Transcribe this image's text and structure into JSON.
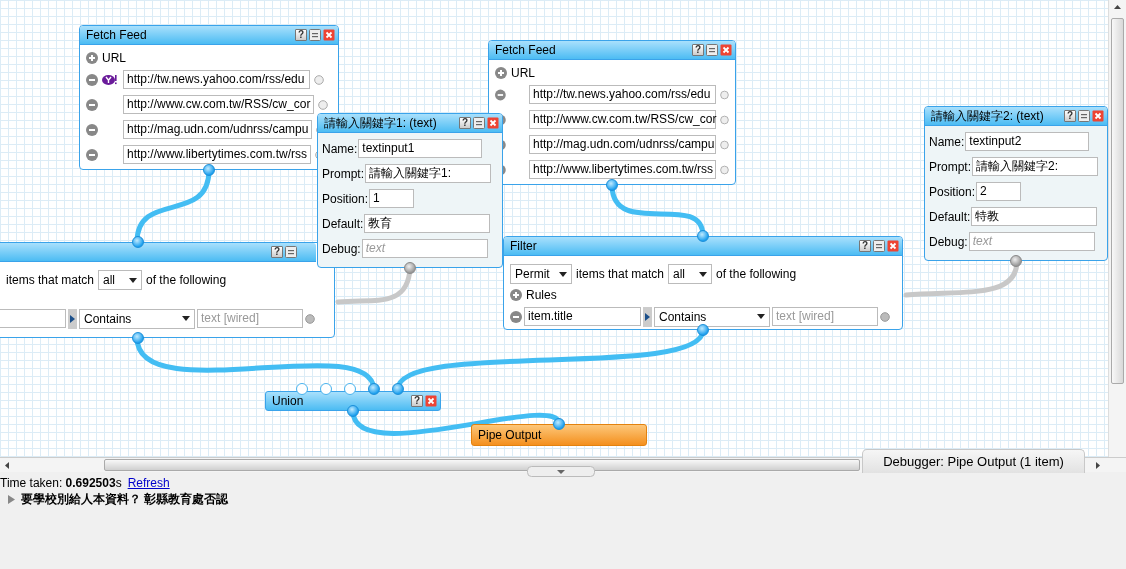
{
  "modules": [
    {
      "kind": "fetch",
      "title": "Fetch Feed",
      "help": "?",
      "close": true,
      "url_label": "URL",
      "urls": [
        {
          "value": "http://tw.news.yahoo.com/rss/edu",
          "yahoo_badge": true
        },
        {
          "value": "http://www.cw.com.tw/RSS/cw_cor",
          "yahoo_badge": false
        },
        {
          "value": "http://mag.udn.com/udnrss/campu",
          "yahoo_badge": false
        },
        {
          "value": "http://www.libertytimes.com.tw/rss",
          "yahoo_badge": false
        }
      ]
    },
    {
      "kind": "fetch",
      "title": "Fetch Feed",
      "help": "?",
      "close": true,
      "url_label": "URL",
      "urls": [
        {
          "value": "http://tw.news.yahoo.com/rss/edu",
          "yahoo_badge": false
        },
        {
          "value": "http://www.cw.com.tw/RSS/cw_cor",
          "yahoo_badge": false
        },
        {
          "value": "http://mag.udn.com/udnrss/campu",
          "yahoo_badge": false
        },
        {
          "value": "http://www.libertytimes.com.tw/rss",
          "yahoo_badge": false
        }
      ]
    },
    {
      "kind": "text_input",
      "title": "請輸入關鍵字2: (text)",
      "help": "?",
      "close": true,
      "fields": [
        {
          "label": "Name:",
          "value": "textinput2"
        },
        {
          "label": "Prompt:",
          "value": "請輸入關鍵字2:"
        },
        {
          "label": "Position:",
          "value": "2"
        },
        {
          "label": "Default:",
          "value": "特教"
        },
        {
          "label": "Debug:",
          "placeholder": "text"
        }
      ]
    },
    {
      "kind": "text_input",
      "title": "請輸入關鍵字1: (text)",
      "help": "?",
      "close": true,
      "fields": [
        {
          "label": "Name:",
          "value": "textinput1"
        },
        {
          "label": "Prompt:",
          "value": "請輸入關鍵字1:"
        },
        {
          "label": "Position:",
          "value": "1"
        },
        {
          "label": "Default:",
          "value": "教育"
        },
        {
          "label": "Debug:",
          "placeholder": "text"
        }
      ]
    },
    {
      "kind": "filter",
      "help": "?",
      "close": false,
      "match_text": "items that match",
      "match": "all",
      "following": "of the following",
      "rule": {
        "op": "Contains",
        "placeholder": "text [wired]"
      }
    },
    {
      "kind": "filter",
      "title": "Filter",
      "help": "?",
      "close": true,
      "mode": "Permit",
      "match_text": "items that match",
      "match": "all",
      "following": "of the following",
      "rules_label": "Rules",
      "rule": {
        "field": "item.title",
        "op": "Contains",
        "placeholder": "text [wired]"
      }
    },
    {
      "kind": "union",
      "title": "Union",
      "help": "?",
      "close": true,
      "inputs": [
        {
          "connected": false
        },
        {
          "connected": false
        },
        {
          "connected": false
        },
        {
          "connected": true
        },
        {
          "connected": true
        }
      ]
    },
    {
      "kind": "output",
      "title": "Pipe Output"
    }
  ],
  "debugger_tab": "Debugger: Pipe Output (1 item)",
  "debugger": {
    "time": "Time taken: **0.692503**s",
    "refresh": "Refresh",
    "results": [
      {
        "title": "要學校別給人本資料？ 彰縣教育處否認",
        "expanded": false
      }
    ]
  }
}
